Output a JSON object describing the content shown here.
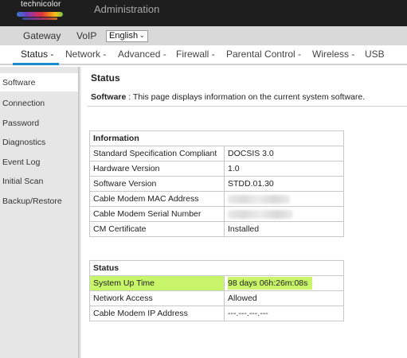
{
  "brand": {
    "logo_text": "technicolor",
    "app_title": "Administration"
  },
  "subnav": {
    "gateway": "Gateway",
    "voip": "VoIP",
    "language": "English"
  },
  "mainnav": [
    {
      "label": "Status -"
    },
    {
      "label": "Network -"
    },
    {
      "label": "Advanced -"
    },
    {
      "label": "Firewall -"
    },
    {
      "label": "Parental Control -"
    },
    {
      "label": "Wireless -"
    },
    {
      "label": "USB"
    }
  ],
  "sidebar": {
    "items": [
      {
        "label": "Software"
      },
      {
        "label": "Connection"
      },
      {
        "label": "Password"
      },
      {
        "label": "Diagnostics"
      },
      {
        "label": "Event Log"
      },
      {
        "label": "Initial Scan"
      },
      {
        "label": "Backup/Restore"
      }
    ]
  },
  "content": {
    "title": "Status",
    "desc_label": "Software",
    "desc_sep": " : ",
    "desc_text": "This page displays information on the current system software."
  },
  "information": {
    "header": "Information",
    "rows": [
      {
        "label": "Standard Specification Compliant",
        "value": "DOCSIS 3.0"
      },
      {
        "label": "Hardware Version",
        "value": "1.0"
      },
      {
        "label": "Software Version",
        "value": "STDD.01.30"
      },
      {
        "label": "Cable Modem MAC Address",
        "value": ""
      },
      {
        "label": "Cable Modem Serial Number",
        "value": ""
      },
      {
        "label": "CM Certificate",
        "value": "Installed"
      }
    ]
  },
  "status": {
    "header": "Status",
    "rows": [
      {
        "label": "System Up Time",
        "value": "98 days 06h:26m:08s"
      },
      {
        "label": "Network Access",
        "value": "Allowed"
      },
      {
        "label": "Cable Modem IP Address",
        "value": "---.---.---.---"
      }
    ]
  },
  "colors": {
    "accent": "#1b8bd0",
    "highlight": "#c8f56a"
  }
}
